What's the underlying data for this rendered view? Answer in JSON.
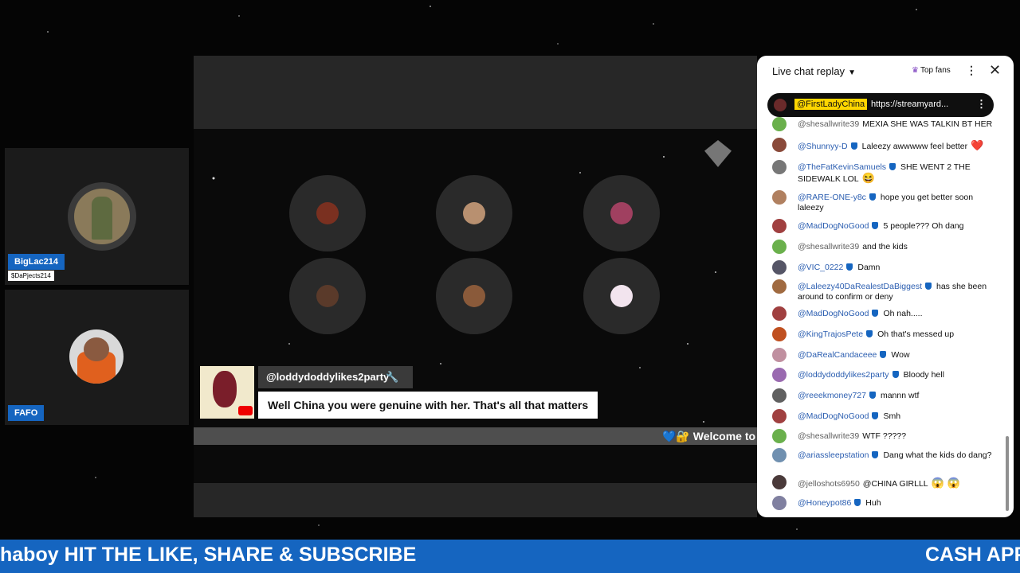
{
  "participants": [
    {
      "name": "BigLac214",
      "subtitle": "$DaPjects214"
    },
    {
      "name": "FAFO"
    }
  ],
  "stage": {
    "featured_comment": {
      "author": "@loddydoddylikes2party",
      "text": "Well China you were genuine with her. That's all that matters"
    },
    "ticker_text": "💙🔐 Welcome to"
  },
  "chat": {
    "title": "Live chat replay",
    "top_fans_label": "Top fans",
    "pinned": {
      "author": "@FirstLadyChina",
      "text": "https://streamyard..."
    },
    "messages": [
      {
        "author": "@shesallwrite39",
        "text": "MEXIA SHE WAS TALKIN BT HER",
        "verified": false,
        "color": "#6ab04c",
        "emoji": ""
      },
      {
        "author": "@Shunnyy-D",
        "text": "Laleezy awwwww feel better",
        "verified": true,
        "color": "#8a4a3a",
        "emoji": "❤️"
      },
      {
        "author": "@TheFatKevinSamuels",
        "text": "SHE WENT 2 THE SIDEWALK LOL",
        "verified": true,
        "color": "#777777",
        "emoji": "😆"
      },
      {
        "author": "@RARE-ONE-y8c",
        "text": "hope you get better soon laleezy",
        "verified": true,
        "color": "#b08060",
        "emoji": ""
      },
      {
        "author": "@MadDogNoGood",
        "text": "5 people??? Oh dang",
        "verified": true,
        "color": "#a04040",
        "emoji": ""
      },
      {
        "author": "@shesallwrite39",
        "text": "and the kids",
        "verified": false,
        "color": "#6ab04c",
        "emoji": ""
      },
      {
        "author": "@VIC_0222",
        "text": "Damn",
        "verified": true,
        "color": "#555566",
        "emoji": ""
      },
      {
        "author": "@Laleezy40DaRealestDaBiggest",
        "text": "has she been around to confirm or deny",
        "verified": true,
        "color": "#a06a40",
        "emoji": ""
      },
      {
        "author": "@MadDogNoGood",
        "text": "Oh nah.....",
        "verified": true,
        "color": "#a04040",
        "emoji": ""
      },
      {
        "author": "@KingTrajosPete",
        "text": "Oh that's messed up",
        "verified": true,
        "color": "#c05020",
        "emoji": ""
      },
      {
        "author": "@DaRealCandaceee",
        "text": "Wow",
        "verified": true,
        "color": "#c090a0",
        "emoji": ""
      },
      {
        "author": "@loddydoddylikes2party",
        "text": "Bloody hell",
        "verified": true,
        "color": "#9a6ab0",
        "emoji": ""
      },
      {
        "author": "@reeekmoney727",
        "text": "mannn wtf",
        "verified": true,
        "color": "#606060",
        "emoji": ""
      },
      {
        "author": "@MadDogNoGood",
        "text": "Smh",
        "verified": true,
        "color": "#a04040",
        "emoji": ""
      },
      {
        "author": "@shesallwrite39",
        "text": "WTF ?????",
        "verified": false,
        "color": "#6ab04c",
        "emoji": ""
      },
      {
        "author": "@ariassleepstation",
        "text": "Dang what the kids do dang?",
        "verified": true,
        "color": "#7090b0",
        "emoji": ""
      },
      {
        "author": "@jelloshots6950",
        "text": "@CHINA GIRLLL",
        "verified": false,
        "color": "#4a3a3a",
        "emoji": "😱 😱"
      },
      {
        "author": "@Honeypot86",
        "text": "Huh",
        "verified": true,
        "color": "#8080a0",
        "emoji": ""
      }
    ]
  },
  "banner": {
    "text_left": "haboy HIT THE LIKE, SHARE & SUBSCRIBE",
    "text_right": "CASH APP"
  }
}
